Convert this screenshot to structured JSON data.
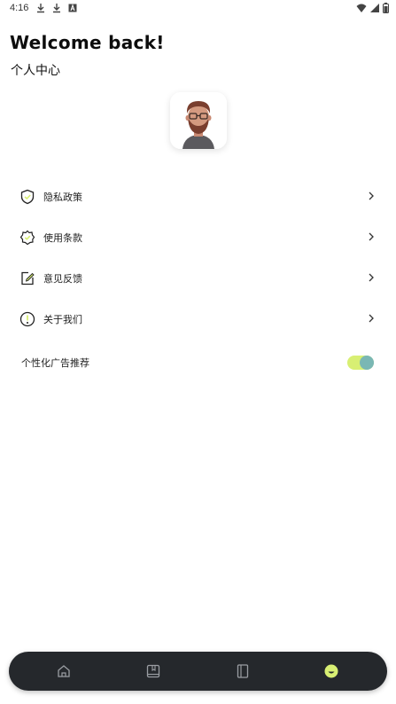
{
  "status_bar": {
    "time": "4:16",
    "left_icons": [
      "download-icon",
      "download-icon",
      "a-icon"
    ],
    "right_icons": [
      "wifi-icon",
      "signal-icon",
      "battery-icon"
    ]
  },
  "header": {
    "welcome": "Welcome back!",
    "subtitle": "个人中心"
  },
  "avatar": {
    "icon": "avatar-man-beard"
  },
  "menu": {
    "items": [
      {
        "label": "隐私政策",
        "icon": "shield-icon"
      },
      {
        "label": "使用条款",
        "icon": "badge-icon"
      },
      {
        "label": "意见反馈",
        "icon": "edit-note-icon"
      },
      {
        "label": "关于我们",
        "icon": "info-icon"
      }
    ]
  },
  "settings": {
    "personalized_ads_label": "个性化广告推荐",
    "personalized_ads_enabled": true
  },
  "bottom_nav": {
    "items": [
      "home-icon",
      "book-icon",
      "notebook-icon",
      "profile-icon"
    ],
    "active_index": 3
  },
  "colors": {
    "accent": "#d8ef73",
    "toggle_knob": "#7ab7b4",
    "nav_bg": "#25282c"
  }
}
